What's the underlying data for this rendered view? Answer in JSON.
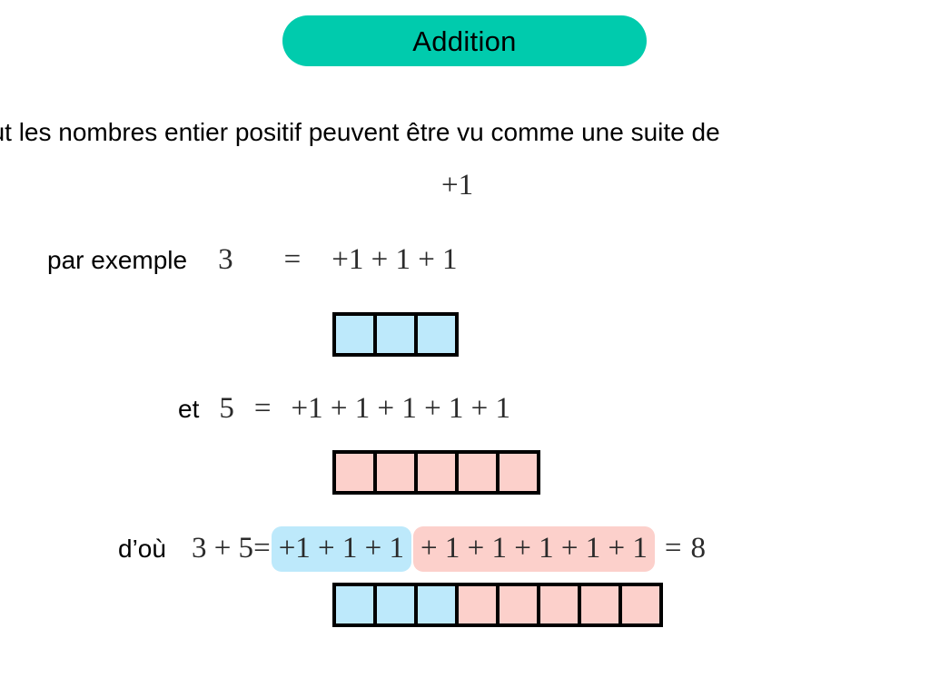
{
  "title": {
    "text": "Addition",
    "pill_color": "#00cbad"
  },
  "intro": {
    "text": "Tout les nombres entier positif peuvent être vu comme une suite de"
  },
  "unit": {
    "plus_one": "+1"
  },
  "example": {
    "label": "par exemple",
    "lhs": "3",
    "equals": "=",
    "rhs": "+1 + 1 + 1"
  },
  "second": {
    "label": "et",
    "lhs": "5",
    "equals": "=",
    "rhs": "+1 + 1 + 1 + 1 + 1"
  },
  "conclusion": {
    "label": "d’où",
    "lhs": "3 + 5",
    "equals": "=",
    "blue_terms": "+1 + 1 + 1",
    "pink_terms": "+ 1 + 1 + 1 + 1 + 1",
    "equals2": "=",
    "result": "8"
  },
  "colors": {
    "blue_fill": "#bde9fb",
    "pink_fill": "#fcd0cb",
    "border": "#000000",
    "teal": "#00cbad"
  },
  "strips": {
    "blue_count": 3,
    "pink_count": 5,
    "mixed_blue_count": 3,
    "mixed_pink_count": 5,
    "total": 8
  }
}
